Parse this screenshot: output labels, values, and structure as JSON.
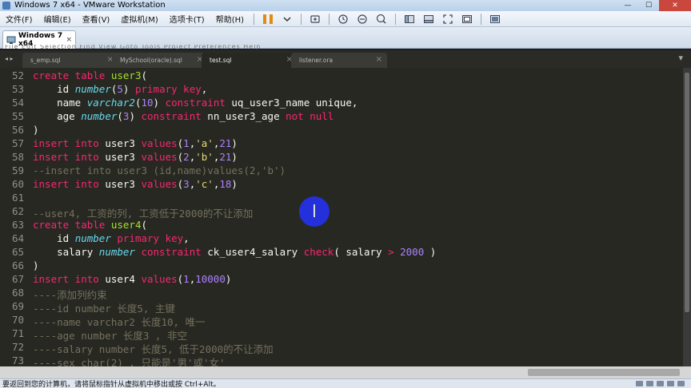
{
  "window": {
    "title": "Windows 7 x64 - VMware Workstation",
    "buttons": [
      "—",
      "☐",
      "✕"
    ]
  },
  "menu": [
    "文件(F)",
    "编辑(E)",
    "查看(V)",
    "虚拟机(M)",
    "选项卡(T)",
    "帮助(H)"
  ],
  "vm_tab": {
    "label": "Windows 7 x64",
    "close": "×"
  },
  "guest_menu_ghost": "File  Edit  Selection  Find  View  Goto  Tools  Project  Preferences  Help",
  "editor_tabs": {
    "nav": "◂ ▸",
    "tabs": [
      {
        "label": "s_emp.sql",
        "active": false
      },
      {
        "label": "MySchool(oracle).sql",
        "active": false
      },
      {
        "label": "test.sql",
        "active": true
      },
      {
        "label": "listener.ora",
        "active": false
      }
    ],
    "close_glyph": "×",
    "more": "▾"
  },
  "code": {
    "line_numbers": [
      "52",
      "53",
      "54",
      "55",
      "56",
      "57",
      "58",
      "59",
      "60",
      "61",
      "62",
      "63",
      "64",
      "65",
      "66",
      "67",
      "68",
      "69",
      "70",
      "71",
      "72",
      "73"
    ]
  },
  "status": {
    "message": "要返回到您的计算机，请将鼠标指针从虚拟机中移出或按 Ctrl+Alt。"
  },
  "colors": {
    "editor_bg": "#272822",
    "keyword": "#f92672",
    "type": "#66d9ef",
    "number": "#ae81ff",
    "string": "#e6db74",
    "function_name": "#a6e22e",
    "comment": "#75715e"
  }
}
